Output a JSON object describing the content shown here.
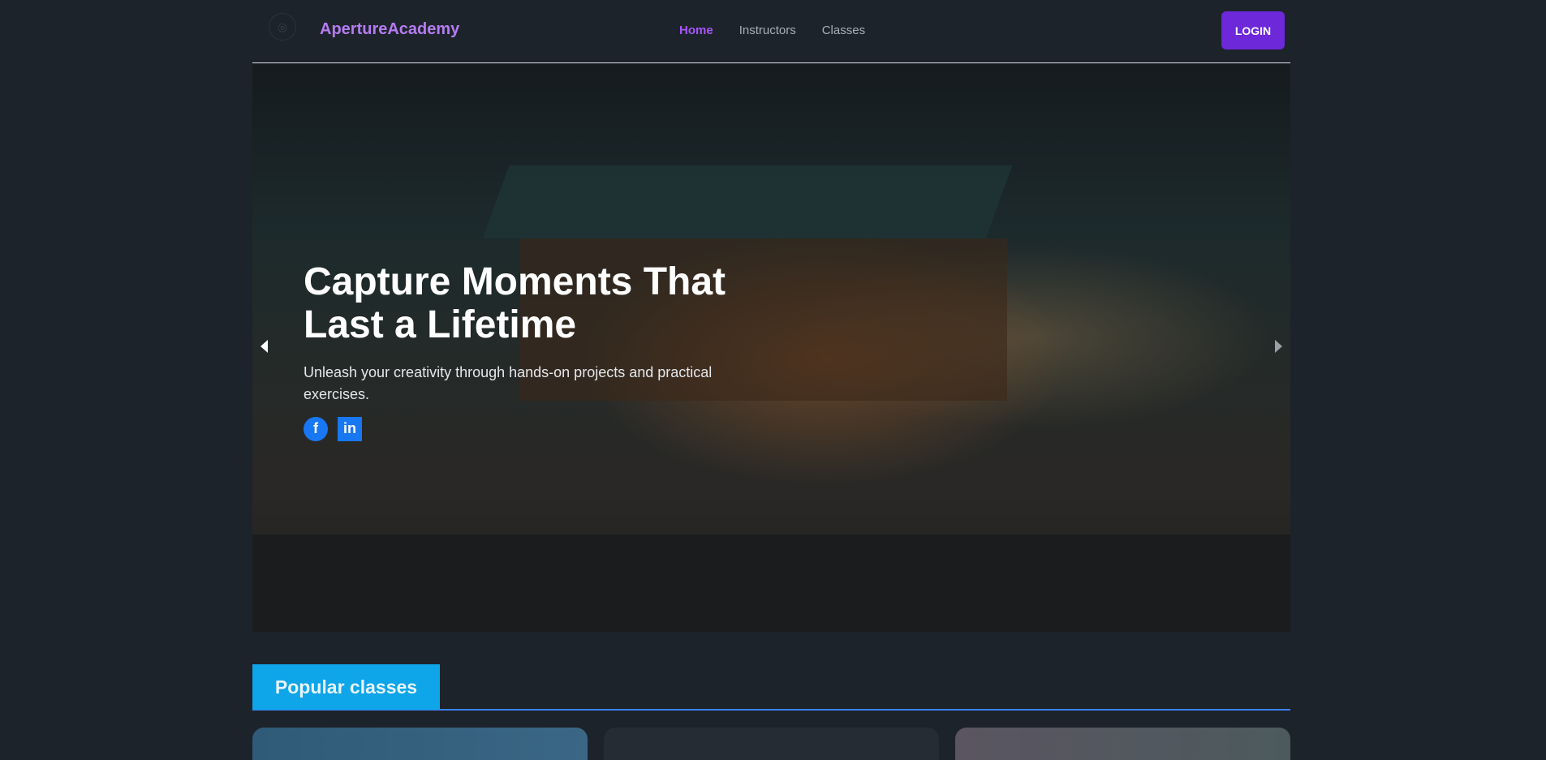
{
  "nav": {
    "brand": "ApertureAcademy",
    "links": [
      "Home",
      "Instructors",
      "Classes"
    ],
    "active": "Home",
    "login": "LOGIN"
  },
  "hero": {
    "title": "Capture Moments That Last a Lifetime",
    "subtitle": "Unleash your creativity through hands-on projects and practical exercises.",
    "social": [
      "facebook-icon",
      "linkedin-icon"
    ]
  },
  "section": {
    "title": "Popular classes"
  },
  "colors": {
    "accent": "#6d28d9",
    "brand": "#b57cf0",
    "section": "#0ea5e9"
  }
}
